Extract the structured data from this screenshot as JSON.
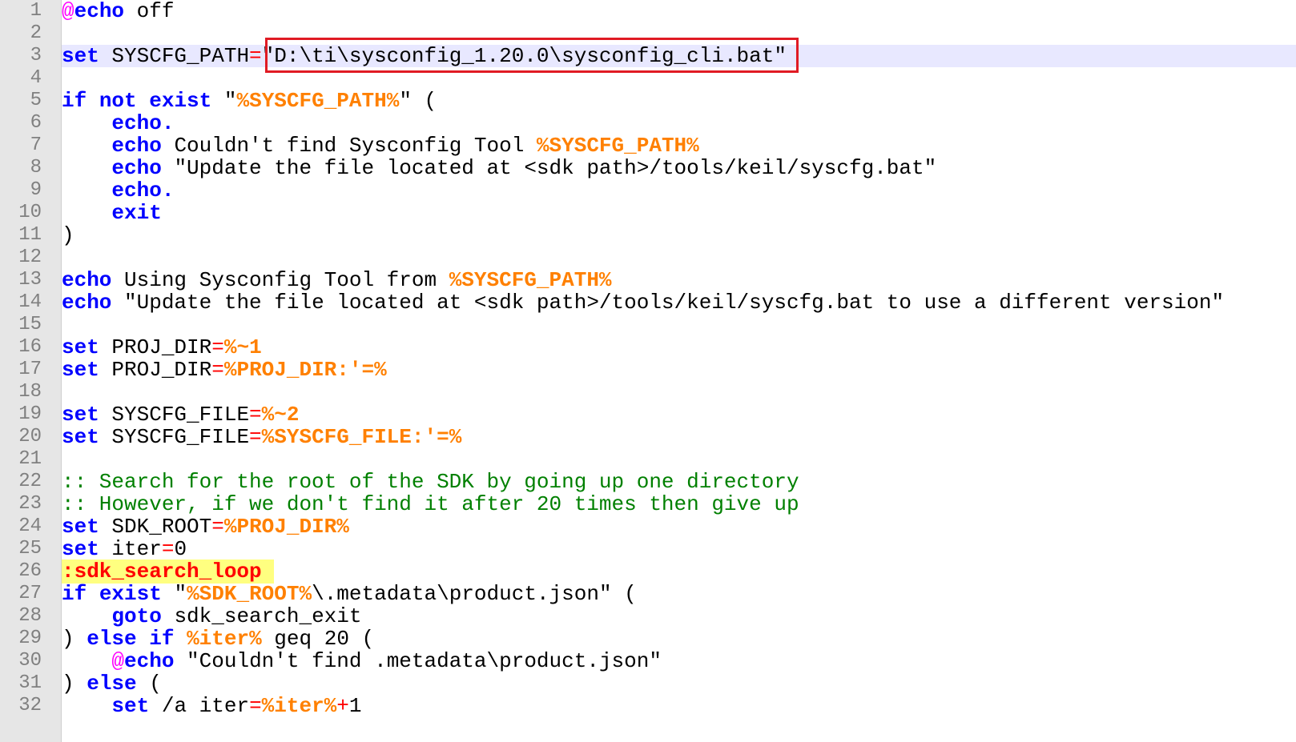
{
  "editor": {
    "current_line": 3,
    "highlight_marker": {
      "line": 3,
      "color": "#e01b24",
      "text": "\"D:\\ti\\sysconfig_1.20.0\\sysconfig_cli.bat\""
    },
    "colors": {
      "keyword": "#0000ff",
      "at_sign": "#ff00ff",
      "operator": "#ff0000",
      "variable": "#ff8000",
      "comment": "#008000",
      "label_text": "#ff0000",
      "label_background": "#ffff80",
      "current_line_background": "#e8e8ff",
      "gutter_background": "#e6e6e6",
      "line_number": "#808080"
    },
    "lines": [
      {
        "n": "1",
        "segs": [
          {
            "t": "@",
            "c": "atsign"
          },
          {
            "t": "echo",
            "c": "kw"
          },
          {
            "t": " off",
            "c": "txt"
          }
        ]
      },
      {
        "n": "2",
        "segs": []
      },
      {
        "n": "3",
        "segs": [
          {
            "t": "set",
            "c": "kw"
          },
          {
            "t": " SYSCFG_PATH",
            "c": "txt"
          },
          {
            "t": "=",
            "c": "op"
          },
          {
            "t": "\"D:\\ti\\sysconfig_1.20.0\\sysconfig_cli.bat\"",
            "c": "txt"
          }
        ]
      },
      {
        "n": "4",
        "segs": []
      },
      {
        "n": "5",
        "segs": [
          {
            "t": "if",
            "c": "kw"
          },
          {
            "t": " ",
            "c": "txt"
          },
          {
            "t": "not",
            "c": "kw"
          },
          {
            "t": " ",
            "c": "txt"
          },
          {
            "t": "exist",
            "c": "kw"
          },
          {
            "t": " \"",
            "c": "txt"
          },
          {
            "t": "%SYSCFG_PATH%",
            "c": "var"
          },
          {
            "t": "\" (",
            "c": "txt"
          }
        ]
      },
      {
        "n": "6",
        "segs": [
          {
            "t": "    ",
            "c": "txt"
          },
          {
            "t": "echo.",
            "c": "kw"
          }
        ]
      },
      {
        "n": "7",
        "segs": [
          {
            "t": "    ",
            "c": "txt"
          },
          {
            "t": "echo",
            "c": "kw"
          },
          {
            "t": " Couldn't find Sysconfig Tool ",
            "c": "txt"
          },
          {
            "t": "%SYSCFG_PATH%",
            "c": "var"
          }
        ]
      },
      {
        "n": "8",
        "segs": [
          {
            "t": "    ",
            "c": "txt"
          },
          {
            "t": "echo",
            "c": "kw"
          },
          {
            "t": " \"Update the file located at <sdk path>/tools/keil/syscfg.bat\"",
            "c": "txt"
          }
        ]
      },
      {
        "n": "9",
        "segs": [
          {
            "t": "    ",
            "c": "txt"
          },
          {
            "t": "echo.",
            "c": "kw"
          }
        ]
      },
      {
        "n": "10",
        "segs": [
          {
            "t": "    ",
            "c": "txt"
          },
          {
            "t": "exit",
            "c": "kw"
          }
        ]
      },
      {
        "n": "11",
        "segs": [
          {
            "t": ")",
            "c": "txt"
          }
        ]
      },
      {
        "n": "12",
        "segs": []
      },
      {
        "n": "13",
        "segs": [
          {
            "t": "echo",
            "c": "kw"
          },
          {
            "t": " Using Sysconfig Tool from ",
            "c": "txt"
          },
          {
            "t": "%SYSCFG_PATH%",
            "c": "var"
          }
        ]
      },
      {
        "n": "14",
        "segs": [
          {
            "t": "echo",
            "c": "kw"
          },
          {
            "t": " \"Update the file located at <sdk path>/tools/keil/syscfg.bat to use a different version\"",
            "c": "txt"
          }
        ]
      },
      {
        "n": "15",
        "segs": []
      },
      {
        "n": "16",
        "segs": [
          {
            "t": "set",
            "c": "kw"
          },
          {
            "t": " PROJ_DIR",
            "c": "txt"
          },
          {
            "t": "=",
            "c": "op"
          },
          {
            "t": "%~1",
            "c": "var"
          }
        ]
      },
      {
        "n": "17",
        "segs": [
          {
            "t": "set",
            "c": "kw"
          },
          {
            "t": " PROJ_DIR",
            "c": "txt"
          },
          {
            "t": "=",
            "c": "op"
          },
          {
            "t": "%PROJ_DIR:'=%",
            "c": "var"
          }
        ]
      },
      {
        "n": "18",
        "segs": []
      },
      {
        "n": "19",
        "segs": [
          {
            "t": "set",
            "c": "kw"
          },
          {
            "t": " SYSCFG_FILE",
            "c": "txt"
          },
          {
            "t": "=",
            "c": "op"
          },
          {
            "t": "%~2",
            "c": "var"
          }
        ]
      },
      {
        "n": "20",
        "segs": [
          {
            "t": "set",
            "c": "kw"
          },
          {
            "t": " SYSCFG_FILE",
            "c": "txt"
          },
          {
            "t": "=",
            "c": "op"
          },
          {
            "t": "%SYSCFG_FILE:'=%",
            "c": "var"
          }
        ]
      },
      {
        "n": "21",
        "segs": []
      },
      {
        "n": "22",
        "segs": [
          {
            "t": ":: Search for the root of the SDK by going up one directory",
            "c": "cmt"
          }
        ]
      },
      {
        "n": "23",
        "segs": [
          {
            "t": ":: However, if we don't find it after 20 times then give up",
            "c": "cmt"
          }
        ]
      },
      {
        "n": "24",
        "segs": [
          {
            "t": "set",
            "c": "kw"
          },
          {
            "t": " SDK_ROOT",
            "c": "txt"
          },
          {
            "t": "=",
            "c": "op"
          },
          {
            "t": "%PROJ_DIR%",
            "c": "var"
          }
        ]
      },
      {
        "n": "25",
        "segs": [
          {
            "t": "set",
            "c": "kw"
          },
          {
            "t": " iter",
            "c": "txt"
          },
          {
            "t": "=",
            "c": "op"
          },
          {
            "t": "0",
            "c": "txt"
          }
        ]
      },
      {
        "n": "26",
        "segs": [
          {
            "t": ":sdk_search_loop ",
            "c": "lbl"
          }
        ]
      },
      {
        "n": "27",
        "segs": [
          {
            "t": "if",
            "c": "kw"
          },
          {
            "t": " ",
            "c": "txt"
          },
          {
            "t": "exist",
            "c": "kw"
          },
          {
            "t": " \"",
            "c": "txt"
          },
          {
            "t": "%SDK_ROOT%",
            "c": "var"
          },
          {
            "t": "\\.metadata\\product.json\" (",
            "c": "txt"
          }
        ]
      },
      {
        "n": "28",
        "segs": [
          {
            "t": "    ",
            "c": "txt"
          },
          {
            "t": "goto",
            "c": "kw"
          },
          {
            "t": " sdk_search_exit",
            "c": "txt"
          }
        ]
      },
      {
        "n": "29",
        "segs": [
          {
            "t": ") ",
            "c": "txt"
          },
          {
            "t": "else",
            "c": "kw"
          },
          {
            "t": " ",
            "c": "txt"
          },
          {
            "t": "if",
            "c": "kw"
          },
          {
            "t": " ",
            "c": "txt"
          },
          {
            "t": "%iter%",
            "c": "var"
          },
          {
            "t": " geq 20 (",
            "c": "txt"
          }
        ]
      },
      {
        "n": "30",
        "segs": [
          {
            "t": "    ",
            "c": "txt"
          },
          {
            "t": "@",
            "c": "atsign"
          },
          {
            "t": "echo",
            "c": "kw"
          },
          {
            "t": " \"Couldn't find .metadata\\product.json\"",
            "c": "txt"
          }
        ]
      },
      {
        "n": "31",
        "segs": [
          {
            "t": ") ",
            "c": "txt"
          },
          {
            "t": "else",
            "c": "kw"
          },
          {
            "t": " (",
            "c": "txt"
          }
        ]
      },
      {
        "n": "32",
        "segs": [
          {
            "t": "    ",
            "c": "txt"
          },
          {
            "t": "set",
            "c": "kw"
          },
          {
            "t": " /a iter",
            "c": "txt"
          },
          {
            "t": "=",
            "c": "op"
          },
          {
            "t": "%iter%",
            "c": "var"
          },
          {
            "t": "+",
            "c": "op"
          },
          {
            "t": "1",
            "c": "txt"
          }
        ]
      }
    ]
  }
}
